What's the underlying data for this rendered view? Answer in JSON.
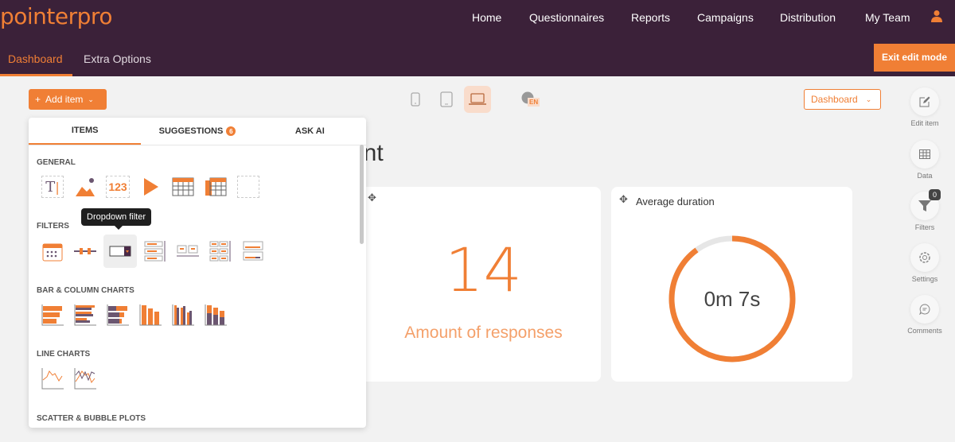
{
  "header": {
    "logo": "pointerpro",
    "nav": [
      "Home",
      "Questionnaires",
      "Reports",
      "Campaigns",
      "Distribution",
      "My Team"
    ],
    "tabs": [
      "Dashboard",
      "Extra Options"
    ],
    "exit_label": "Exit edit mode"
  },
  "toolbar": {
    "add_item": "Add item",
    "language": "EN",
    "dashboard_select": "Dashboard"
  },
  "page": {
    "title": "ent"
  },
  "cards": [
    {
      "value": "14",
      "label": "Amount of responses"
    },
    {
      "title": "Average duration",
      "value": "0m 7s",
      "progress": 0.9
    }
  ],
  "panel": {
    "tabs": [
      "ITEMS",
      "SUGGESTIONS",
      "ASK AI"
    ],
    "suggestions_count": "6",
    "sections": [
      "GENERAL",
      "FILTERS",
      "BAR & COLUMN CHARTS",
      "LINE CHARTS",
      "SCATTER & BUBBLE PLOTS"
    ],
    "tooltip": "Dropdown filter",
    "general_icons": [
      "text",
      "image",
      "number",
      "video",
      "table",
      "multi-table",
      "empty"
    ]
  },
  "sidebar": [
    {
      "label": "Edit item",
      "icon": "edit-icon"
    },
    {
      "label": "Data",
      "icon": "table-icon"
    },
    {
      "label": "Filters",
      "icon": "filter-icon",
      "badge": "0"
    },
    {
      "label": "Settings",
      "icon": "gear-icon"
    },
    {
      "label": "Comments",
      "icon": "comment-icon"
    }
  ],
  "colors": {
    "brand": "#f07f35",
    "header": "#3b2139",
    "accent2": "#6b5670"
  }
}
